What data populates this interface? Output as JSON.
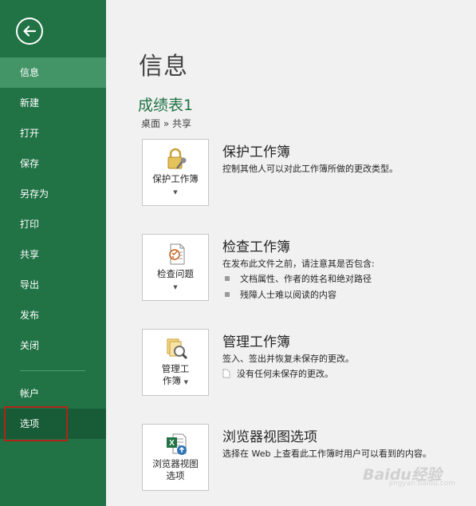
{
  "sidebar": {
    "items": [
      {
        "label": "信息"
      },
      {
        "label": "新建"
      },
      {
        "label": "打开"
      },
      {
        "label": "保存"
      },
      {
        "label": "另存为"
      },
      {
        "label": "打印"
      },
      {
        "label": "共享"
      },
      {
        "label": "导出"
      },
      {
        "label": "发布"
      },
      {
        "label": "关闭"
      },
      {
        "label": "帐户"
      },
      {
        "label": "选项"
      }
    ],
    "back_icon": "back-arrow-icon"
  },
  "main": {
    "title": "信息",
    "doc_name": "成绩表1",
    "breadcrumb": "桌面 » 共享",
    "sections": [
      {
        "button_label": "保护工作簿",
        "title": "保护工作簿",
        "desc": "控制其他人可以对此工作簿所做的更改类型。",
        "icon": "lock-key-icon"
      },
      {
        "button_label": "检查问题",
        "title": "检查工作簿",
        "desc": "在发布此文件之前，请注意其是否包含:",
        "bullets": [
          "文档属性、作者的姓名和绝对路径",
          "残障人士难以阅读的内容"
        ],
        "icon": "inspect-document-icon"
      },
      {
        "button_label_1": "管理工",
        "button_label_2": "作簿",
        "title": "管理工作簿",
        "desc": "签入、签出并恢复未保存的更改。",
        "note": "没有任何未保存的更改。",
        "icon": "manage-versions-icon"
      },
      {
        "button_label_1": "浏览器视图",
        "button_label_2": "选项",
        "title": "浏览器视图选项",
        "desc": "选择在 Web 上查看此工作簿时用户可以看到的内容。",
        "icon": "excel-web-icon"
      }
    ]
  },
  "watermark": {
    "text": "Baidu经验",
    "sub": "jingyan.baidu.com"
  },
  "colors": {
    "sidebar": "#217346",
    "active": "#439467",
    "highlight": "#b02418",
    "accent_text": "#217346"
  }
}
